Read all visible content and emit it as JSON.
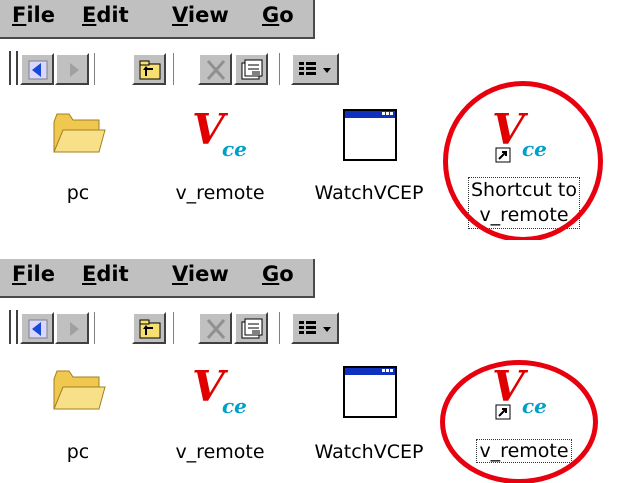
{
  "screens": [
    {
      "menu": {
        "file": {
          "mnemonic": "F",
          "rest": "ile"
        },
        "edit": {
          "mnemonic": "E",
          "rest": "dit"
        },
        "view": {
          "mnemonic": "V",
          "rest": "iew"
        },
        "go": {
          "mnemonic": "G",
          "rest": "o"
        }
      },
      "files": [
        {
          "label": "pc",
          "icon": "folder-icon"
        },
        {
          "label": "v_remote",
          "icon": "vce-app-icon"
        },
        {
          "label": "WatchVCEP",
          "icon": "window-app-icon"
        },
        {
          "label_line1": "Shortcut to",
          "label_line2": "v_remote",
          "icon": "vce-shortcut-icon"
        }
      ]
    },
    {
      "menu": {
        "file": {
          "mnemonic": "F",
          "rest": "ile"
        },
        "edit": {
          "mnemonic": "E",
          "rest": "dit"
        },
        "view": {
          "mnemonic": "V",
          "rest": "iew"
        },
        "go": {
          "mnemonic": "G",
          "rest": "o"
        }
      },
      "files": [
        {
          "label": "pc",
          "icon": "folder-icon"
        },
        {
          "label": "v_remote",
          "icon": "vce-app-icon"
        },
        {
          "label": "WatchVCEP",
          "icon": "window-app-icon"
        },
        {
          "label": "v_remote",
          "icon": "vce-shortcut-icon"
        }
      ]
    }
  ],
  "toolbar_icons": [
    "back-arrow-icon",
    "forward-arrow-icon",
    "up-folder-icon",
    "delete-icon",
    "properties-icon",
    "view-menu-icon"
  ],
  "colors": {
    "callout": "#e8000f",
    "menubar": "#c0c0c0",
    "vce_red": "#e00000",
    "vce_cyan": "#00a0c8"
  }
}
